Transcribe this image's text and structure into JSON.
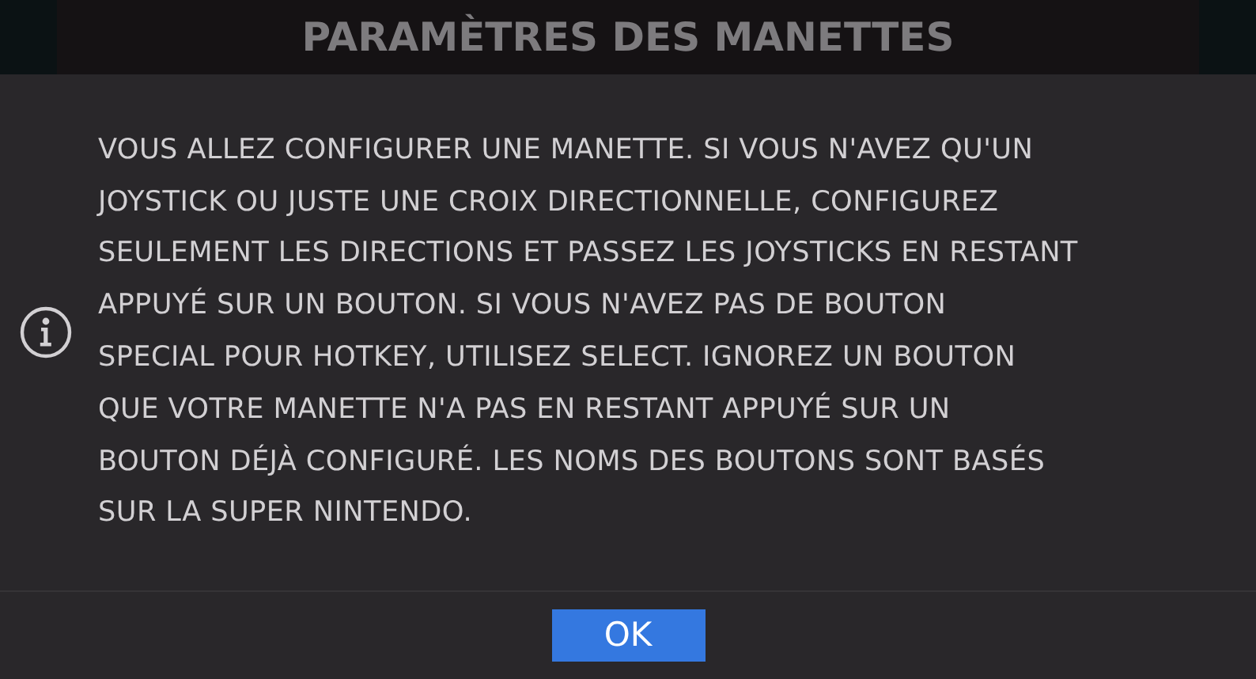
{
  "background_title": "PARAMÈTRES DES MANETTES",
  "dialog": {
    "message_lines": [
      "VOUS ALLEZ CONFIGURER UNE MANETTE. SI VOUS N'AVEZ QU'UN",
      "JOYSTICK OU JUSTE UNE CROIX DIRECTIONNELLE, CONFIGUREZ",
      "SEULEMENT LES DIRECTIONS ET PASSEZ LES JOYSTICKS EN RESTANT",
      "APPUYÉ SUR UN BOUTON. SI VOUS N'AVEZ PAS DE BOUTON",
      "SPECIAL POUR HOTKEY, UTILISEZ SELECT. IGNOREZ UN BOUTON",
      "QUE VOTRE MANETTE N'A PAS EN RESTANT APPUYÉ SUR UN",
      "BOUTON DÉJÀ CONFIGURÉ. LES NOMS DES BOUTONS SONT BASÉS",
      "SUR LA SUPER NINTENDO."
    ],
    "buttons": [
      {
        "label": "OK",
        "selected": true
      }
    ]
  }
}
